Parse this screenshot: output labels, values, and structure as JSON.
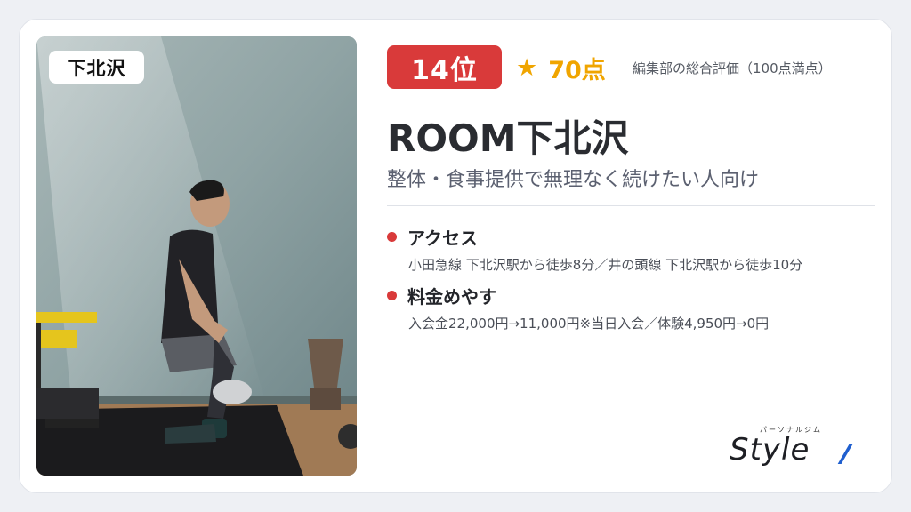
{
  "area_tag": "下北沢",
  "rank": "14位",
  "score": {
    "star": "★",
    "value": "70点",
    "note": "編集部の総合評価（100点満点）"
  },
  "gym_name": "ROOM下北沢",
  "tagline": "整体・食事提供で無理なく続けたい人向け",
  "info": [
    {
      "label": "アクセス",
      "text": "小田急線 下北沢駅から徒歩8分／井の頭線 下北沢駅から徒歩10分"
    },
    {
      "label": "料金めやす",
      "text": "入会金22,000円→11,000円※当日入会／体験4,950円→0円"
    }
  ],
  "logo": {
    "ruby": "パーソナルジム",
    "word": "Style"
  },
  "colors": {
    "accent_red": "#d93a3a",
    "score_gold": "#f0a500",
    "logo_blue": "#1f5fcf"
  },
  "photo_description_icon": "gym-photo-man-squatting"
}
